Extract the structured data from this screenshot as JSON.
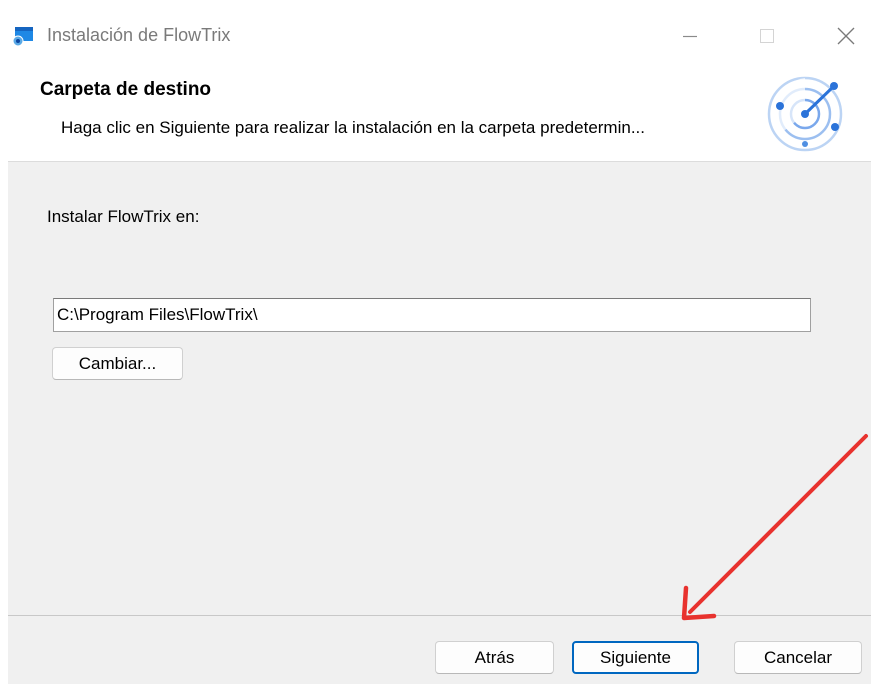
{
  "window": {
    "title": "Instalación de FlowTrix"
  },
  "banner": {
    "title": "Carpeta de destino",
    "subtitle": "Haga clic en Siguiente para realizar la instalación en la carpeta predetermin..."
  },
  "body": {
    "install_label": "Instalar FlowTrix en:",
    "install_path": "C:\\Program Files\\FlowTrix\\",
    "change_label": "Cambiar..."
  },
  "footer": {
    "back_label": "Atrás",
    "next_label": "Siguiente",
    "cancel_label": "Cancelar"
  },
  "icons": {
    "app": "installer-icon",
    "logo": "radar-logo-icon",
    "minimize": "minimize-icon",
    "maximize": "maximize-icon",
    "close": "close-icon",
    "annotation": "red-arrow-annotation"
  },
  "colors": {
    "accent": "#0067c0",
    "annotation": "#e8322e",
    "logo": "#2b73d9"
  }
}
